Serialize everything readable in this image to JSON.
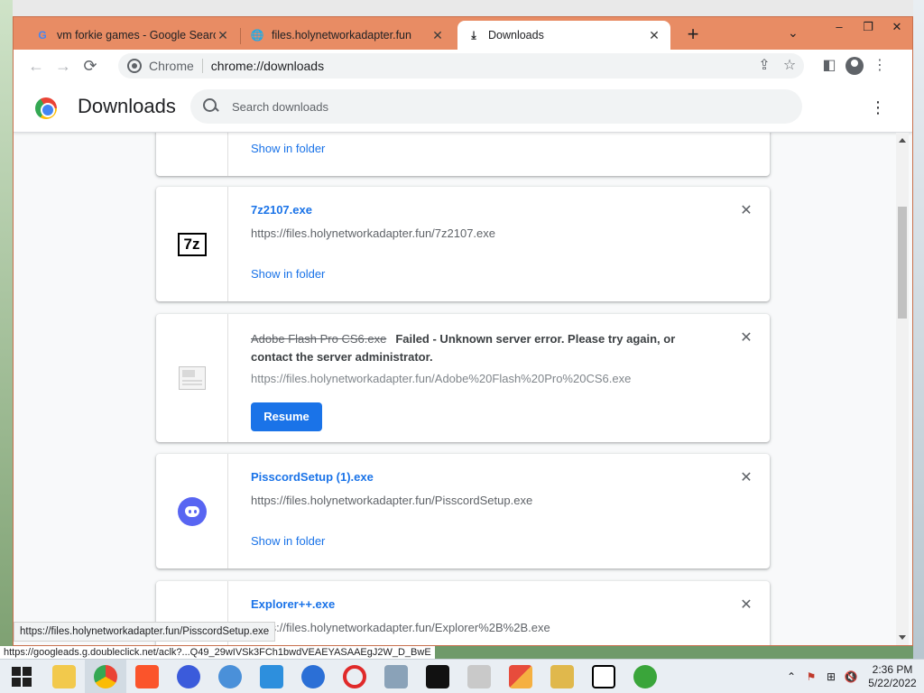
{
  "tabs": [
    {
      "title": "vm forkie games - Google Search",
      "favicon": "google-icon",
      "active": false
    },
    {
      "title": "files.holynetworkadapter.fun",
      "favicon": "globe-icon",
      "active": false
    },
    {
      "title": "Downloads",
      "favicon": "download-icon",
      "active": true
    }
  ],
  "window_controls": {
    "minimize": "–",
    "restore": "❐",
    "close": "✕"
  },
  "toolbar": {
    "site_label": "Chrome",
    "url": "chrome://downloads"
  },
  "page": {
    "title": "Downloads",
    "search_placeholder": "Search downloads"
  },
  "downloads": [
    {
      "link": "Show in folder"
    },
    {
      "name": "7z2107.exe",
      "url": "https://files.holynetworkadapter.fun/7z2107.exe",
      "link": "Show in folder",
      "icon": "7z-icon",
      "icon_text": "7z"
    },
    {
      "name": "Adobe Flash Pro CS6.exe",
      "error": "Failed - Unknown server error. Please try again, or contact the server administrator.",
      "url": "https://files.holynetworkadapter.fun/Adobe%20Flash%20Pro%20CS6.exe",
      "button": "Resume",
      "icon": "file-icon"
    },
    {
      "name": "PisscordSetup (1).exe",
      "url": "https://files.holynetworkadapter.fun/PisscordSetup.exe",
      "link": "Show in folder",
      "icon": "discord-icon"
    },
    {
      "name": "Explorer++.exe",
      "url": "https://files.holynetworkadapter.fun/Explorer%2B%2B.exe"
    }
  ],
  "status_bubble": "https://files.holynetworkadapter.fun/PisscordSetup.exe",
  "ads_url": "https://googleads.g.doubleclick.net/aclk?...Q49_29wIVSk3FCh1bwdVEAEYASAAEgJ2W_D_BwE",
  "taskbar": {
    "time": "2:36 PM",
    "date": "5/22/2022",
    "apps": [
      "file-explorer",
      "chrome",
      "brave",
      "firefox",
      "chromium",
      "app",
      "firefox-dev",
      "opera",
      "task-manager",
      "terminal",
      "java",
      "control-panel",
      "folder",
      "7zip",
      "utorrent"
    ]
  },
  "colors": {
    "frame": "#e88c64",
    "link": "#1a73e8",
    "resume": "#1a73e8"
  }
}
